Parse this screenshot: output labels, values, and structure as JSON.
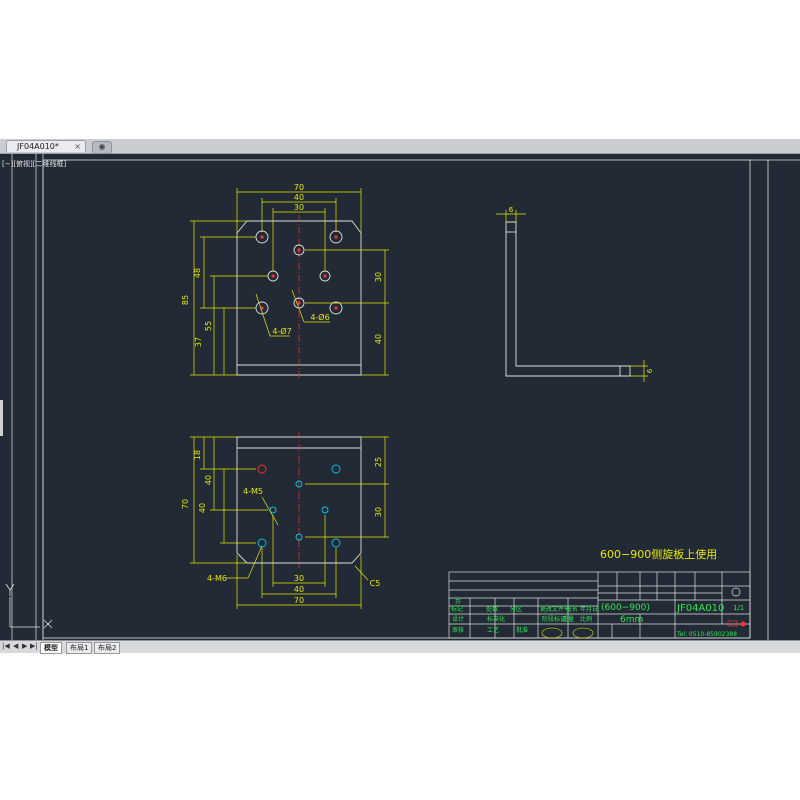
{
  "document_tab": {
    "title": "JF04A010*",
    "close": "×"
  },
  "viewport_label": "[−][俯视][二维线框]",
  "layout_tabs": [
    "模型",
    "布局1",
    "布局2"
  ],
  "nav_buttons": [
    "|◀",
    "◀",
    "▶",
    "▶|"
  ],
  "drawing": {
    "top_view": {
      "dim_width": "70",
      "dim_40": "40",
      "dim_30": "30",
      "dim_85": "85",
      "dim_48": "48",
      "dim_55": "55",
      "dim_37": "37",
      "dim_right_30": "30",
      "dim_right_40": "40",
      "callout_holes_7": "4-Ø7",
      "callout_holes_6": "4-Ø6"
    },
    "side_view": {
      "dim_top": "6",
      "dim_bottom": "6"
    },
    "bottom_view": {
      "dim_70_left": "70",
      "dim_18": "18",
      "dim_40_a": "40",
      "dim_40_b": "40",
      "dim_right_25": "25",
      "dim_right_30": "30",
      "dim_30": "30",
      "dim_40": "40",
      "dim_70": "70",
      "callout_m5": "4-M5",
      "callout_m6": "4-M6",
      "chamfer": "C5"
    },
    "note": "600−900侧旋板上使用",
    "title_block": {
      "label_material_row": "(600−900)",
      "label_thickness": "6mm",
      "drawing_no": "JF04A010",
      "scale": "1/1",
      "tel": "Tel: 0510-85902388",
      "cell_company": "开",
      "header_labels": [
        "标记",
        "处数",
        "分区",
        "更改文件号",
        "签名",
        "年月日"
      ],
      "row_labels": [
        "设计",
        "标准化",
        "阶段标记",
        "重量",
        "比例"
      ],
      "row2_labels": [
        "审核",
        "工艺",
        "批准"
      ]
    }
  }
}
